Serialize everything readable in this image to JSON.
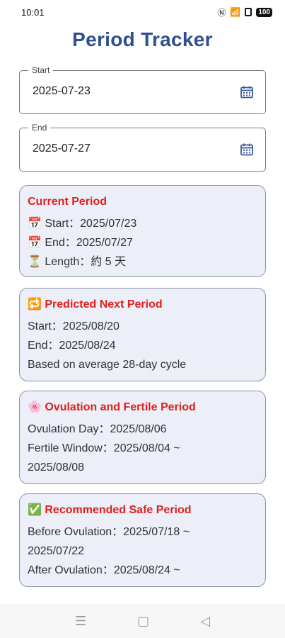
{
  "status": {
    "time": "10:01",
    "battery": "100"
  },
  "title": "Period Tracker",
  "start_field": {
    "label": "Start",
    "value": "2025-07-23"
  },
  "end_field": {
    "label": "End",
    "value": "2025-07-27"
  },
  "current_period": {
    "title": "Current Period",
    "start": "📅 Start：2025/07/23",
    "end": "📅 End：2025/07/27",
    "length": "⏳ Length：約 5 天"
  },
  "predicted_next": {
    "title": "🔁 Predicted Next Period",
    "start": "Start：2025/08/20",
    "end": "End：2025/08/24",
    "note": "Based on average 28-day cycle"
  },
  "ovulation": {
    "title": "🌸 Ovulation and Fertile Period",
    "day": "Ovulation Day：2025/08/06",
    "window_1": "Fertile Window：2025/08/04 ~",
    "window_2": "2025/08/08"
  },
  "safe_period": {
    "title": "✅ Recommended Safe Period",
    "before_1": "Before Ovulation：2025/07/18 ~",
    "before_2": "2025/07/22",
    "after": "After Ovulation：2025/08/24 ~"
  },
  "nav": {
    "menu_icon": "☰",
    "home_icon": "▢",
    "back_icon": "◁"
  },
  "colors": {
    "title": "#2f4f8f",
    "card_title": "#e0201b",
    "card_bg": "#eceef8"
  }
}
